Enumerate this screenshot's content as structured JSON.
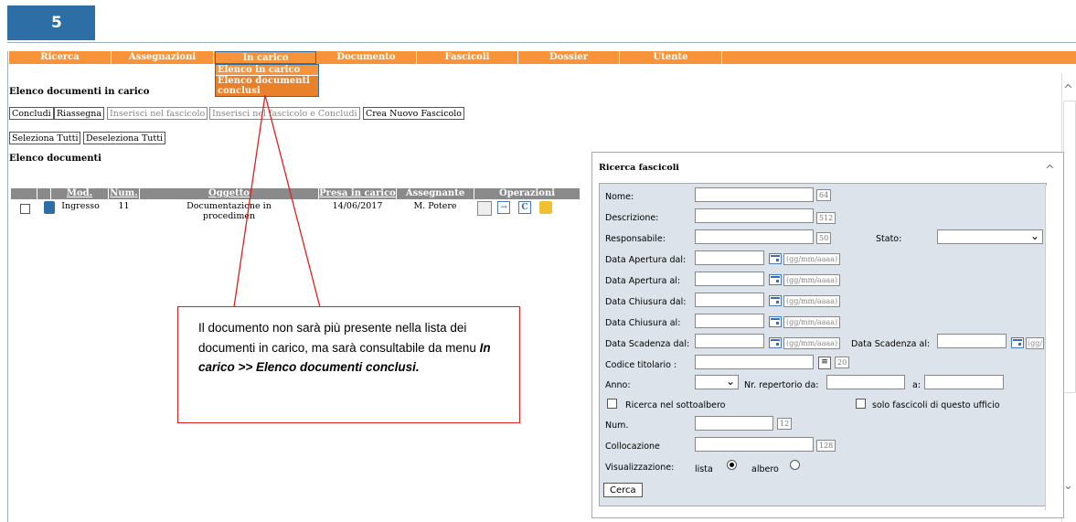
{
  "step": "5",
  "menu": {
    "items": [
      "Ricerca",
      "Assegnazioni",
      "In carico",
      "Documento",
      "Fascicoli",
      "Dossier",
      "Utente"
    ],
    "dropdown": [
      "Elenco in carico",
      "Elenco documenti",
      "conclusi"
    ]
  },
  "page_title": "Elenco documenti in carico",
  "buttons": {
    "concludi": "Concludi",
    "riassegna": "Riassegna",
    "inserisci": "Inserisci nel fascicolo",
    "inserisci_concludi": "Inserisci nel fascicolo e Concludi",
    "crea": "Crea Nuovo Fascicolo",
    "seleziona": "Seleziona Tutti",
    "deseleziona": "Deseleziona Tutti"
  },
  "list_title": "Elenco documenti",
  "table": {
    "headers": [
      "Mod.",
      "Num.",
      "Oggetto",
      "Presa in carico",
      "Assegnante",
      "Operazioni"
    ],
    "row": {
      "mod": "Ingresso",
      "num": "11",
      "oggetto_1": "Documentazione in",
      "oggetto_2": "procedimen",
      "presa": "14/06/2017",
      "assegnante": "M. Potere"
    }
  },
  "callout": {
    "text": "Il documento non sarà più presente nella lista dei documenti in carico, ma sarà consultabile da menu ",
    "bold": "In carico >> Elenco documenti conclusi."
  },
  "search": {
    "title": "Ricerca fascicoli",
    "nome": "Nome:",
    "nome_max": "64",
    "descrizione": "Descrizione:",
    "descrizione_max": "512",
    "responsabile": "Responsabile:",
    "responsabile_max": "50",
    "stato": "Stato:",
    "apertura_dal": "Data Apertura dal:",
    "apertura_al": "Data Apertura al:",
    "chiusura_dal": "Data Chiusura dal:",
    "chiusura_al": "Data Chiusura al:",
    "scadenza_dal": "Data Scadenza dal:",
    "scadenza_al": "Data Scadenza al:",
    "date_fmt": "(gg/mm/aaaa)",
    "date_fmt_cut": "(gg/",
    "codice": "Codice titolario :",
    "codice_max": "20",
    "anno": "Anno:",
    "repertorio_da": "Nr. repertorio da:",
    "a": "a:",
    "sottoalbero": "Ricerca nel sottoalbero",
    "ufficio": "solo fascicoli di questo ufficio",
    "num": "Num.",
    "num_max": "12",
    "collocazione": "Collocazione",
    "collocazione_max": "128",
    "visualizzazione": "Visualizzazione:",
    "lista": "lista",
    "albero": "albero",
    "cerca": "Cerca"
  }
}
